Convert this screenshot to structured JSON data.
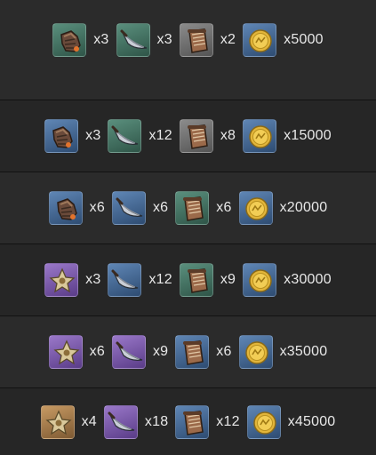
{
  "rows": [
    {
      "items": [
        {
          "icon": "gauntlet-icon",
          "rarity": "green",
          "qty": "x3"
        },
        {
          "icon": "blade-icon",
          "rarity": "green",
          "qty": "x3"
        },
        {
          "icon": "scroll-icon",
          "rarity": "gray",
          "qty": "x2"
        },
        {
          "icon": "coin-icon",
          "rarity": "blue",
          "qty": "x5000"
        }
      ]
    },
    {
      "items": [
        {
          "icon": "gauntlet-icon",
          "rarity": "blue",
          "qty": "x3"
        },
        {
          "icon": "blade-icon",
          "rarity": "green",
          "qty": "x12"
        },
        {
          "icon": "scroll-icon",
          "rarity": "gray",
          "qty": "x8"
        },
        {
          "icon": "coin-icon",
          "rarity": "blue",
          "qty": "x15000"
        }
      ]
    },
    {
      "items": [
        {
          "icon": "gauntlet-icon",
          "rarity": "blue",
          "qty": "x6"
        },
        {
          "icon": "blade-icon",
          "rarity": "blue",
          "qty": "x6"
        },
        {
          "icon": "scroll-icon",
          "rarity": "green",
          "qty": "x6"
        },
        {
          "icon": "coin-icon",
          "rarity": "blue",
          "qty": "x20000"
        }
      ]
    },
    {
      "items": [
        {
          "icon": "star-relic-icon",
          "rarity": "purple",
          "qty": "x3"
        },
        {
          "icon": "blade-icon",
          "rarity": "blue",
          "qty": "x12"
        },
        {
          "icon": "scroll-icon",
          "rarity": "green",
          "qty": "x9"
        },
        {
          "icon": "coin-icon",
          "rarity": "blue",
          "qty": "x30000"
        }
      ]
    },
    {
      "items": [
        {
          "icon": "star-relic-icon",
          "rarity": "purple",
          "qty": "x6"
        },
        {
          "icon": "blade-icon",
          "rarity": "purple",
          "qty": "x9"
        },
        {
          "icon": "scroll-icon",
          "rarity": "blue",
          "qty": "x6"
        },
        {
          "icon": "coin-icon",
          "rarity": "blue",
          "qty": "x35000"
        }
      ]
    },
    {
      "items": [
        {
          "icon": "star-relic-icon",
          "rarity": "gold",
          "qty": "x4"
        },
        {
          "icon": "blade-icon",
          "rarity": "purple",
          "qty": "x18"
        },
        {
          "icon": "scroll-icon",
          "rarity": "blue",
          "qty": "x12"
        },
        {
          "icon": "coin-icon",
          "rarity": "blue",
          "qty": "x45000"
        }
      ]
    }
  ]
}
